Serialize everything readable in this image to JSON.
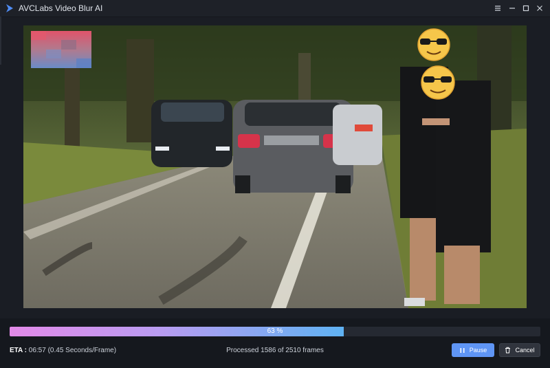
{
  "app": {
    "title": "AVCLabs Video Blur AI"
  },
  "window_controls": {
    "menu_icon": "menu-icon",
    "minimize_icon": "minimize-icon",
    "maximize_icon": "maximize-icon",
    "close_icon": "close-icon"
  },
  "preview": {
    "blur_effects": [
      "mosaic-blur-region",
      "emoji-face-mask",
      "emoji-face-mask"
    ],
    "face_mask_icon": "sunglasses-emoji-icon"
  },
  "progress": {
    "percent": 63,
    "label": "63 %",
    "colors": {
      "fill_start": "#e28ae8",
      "fill_end": "#5fb2f3",
      "track": "#252932"
    }
  },
  "status": {
    "eta_label": "ETA :",
    "eta_value": "06:57 (0.45 Seconds/Frame)",
    "processed_text": "Processed 1586 of 2510 frames"
  },
  "buttons": {
    "pause_label": "Pause",
    "pause_icon": "pause-icon",
    "cancel_label": "Cancel",
    "cancel_icon": "trash-icon"
  },
  "theme": {
    "background": "#1a1d24",
    "accent": "#5f95f5"
  }
}
